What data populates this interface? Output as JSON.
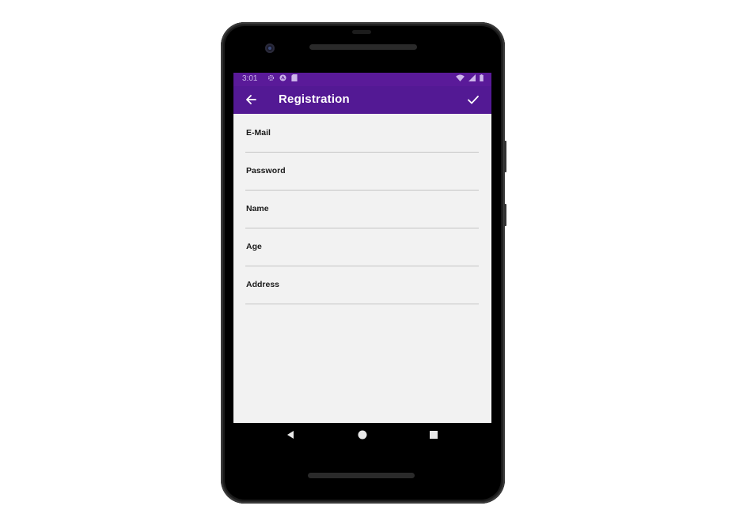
{
  "status_bar": {
    "time": "3:01",
    "left_icons": [
      "settings-icon",
      "android-icon",
      "sd-card-icon"
    ],
    "right_icons": [
      "wifi-icon",
      "signal-icon",
      "battery-icon"
    ]
  },
  "app_bar": {
    "title": "Registration",
    "back_icon": "arrow-left-icon",
    "action_icon": "check-icon"
  },
  "form": {
    "fields": [
      {
        "label": "E-Mail",
        "value": "",
        "placeholder": ""
      },
      {
        "label": "Password",
        "value": "",
        "placeholder": ""
      },
      {
        "label": "Name",
        "value": "",
        "placeholder": ""
      },
      {
        "label": "Age",
        "value": "",
        "placeholder": ""
      },
      {
        "label": "Address",
        "value": "",
        "placeholder": ""
      }
    ]
  },
  "nav_bar": {
    "buttons": [
      "back-triangle-icon",
      "home-circle-icon",
      "recents-square-icon"
    ]
  },
  "colors": {
    "status_bar": "#5a1a99",
    "app_bar": "#531994",
    "screen_bg": "#f2f2f2",
    "field_underline": "#c4c4c4"
  }
}
